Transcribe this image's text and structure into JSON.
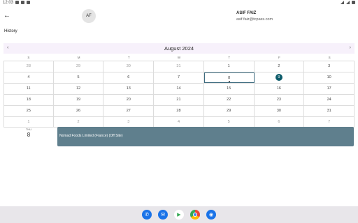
{
  "status_bar": {
    "time": "12:03"
  },
  "header": {
    "avatar_initials": "AF",
    "user_name": "ASIF FAIZ",
    "user_email": "asif.faiz@tcpass.com",
    "section_title": "History"
  },
  "calendar": {
    "month_label": "August 2024",
    "weekdays": [
      "S",
      "M",
      "T",
      "W",
      "T",
      "F",
      "S"
    ],
    "weeks": [
      [
        "28",
        "29",
        "30",
        "31",
        "1",
        "2",
        "3"
      ],
      [
        "4",
        "5",
        "6",
        "7",
        "8",
        "9",
        "10"
      ],
      [
        "11",
        "12",
        "13",
        "14",
        "15",
        "16",
        "17"
      ],
      [
        "18",
        "19",
        "20",
        "21",
        "22",
        "23",
        "24"
      ],
      [
        "25",
        "26",
        "27",
        "28",
        "29",
        "30",
        "31"
      ],
      [
        "1",
        "2",
        "3",
        "4",
        "5",
        "6",
        "7"
      ]
    ],
    "selected_day": "8",
    "today": "9"
  },
  "agenda": {
    "day_name": "THU",
    "day_number": "8",
    "event_title": "Nomad Foods Limited (France)  (Off Site)"
  },
  "colors": {
    "accent": "#0d5c6b",
    "event_bg": "#5f7f8d",
    "month_bar": "#f7f1fb"
  },
  "navbar": {
    "apps": [
      "phone-icon",
      "messages-icon",
      "play-store-icon",
      "chrome-icon",
      "camera-icon"
    ]
  }
}
